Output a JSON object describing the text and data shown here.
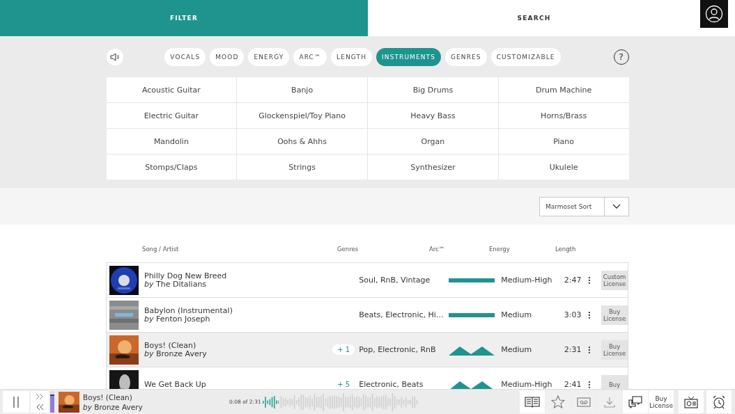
{
  "top_tabs": [
    {
      "label": "FILTER",
      "selected": true
    },
    {
      "label": "SEARCH",
      "selected": false
    }
  ],
  "filter_tabs": [
    {
      "label": "VOCALS",
      "selected": false
    },
    {
      "label": "MOOD",
      "selected": false
    },
    {
      "label": "ENERGY",
      "selected": false
    },
    {
      "label": "ARC™",
      "selected": false
    },
    {
      "label": "LENGTH",
      "selected": false
    },
    {
      "label": "INSTRUMENTS",
      "selected": true
    },
    {
      "label": "GENRES",
      "selected": false
    },
    {
      "label": "CUSTOMIZABLE",
      "selected": false
    }
  ],
  "help": "?",
  "instruments": [
    "Acoustic Guitar",
    "Banjo",
    "Big Drums",
    "Drum Machine",
    "Electric Guitar",
    "Glockenspiel/Toy Piano",
    "Heavy Bass",
    "Horns/Brass",
    "Mandolin",
    "Oohs & Ahhs",
    "Organ",
    "Piano",
    "Stomps/Claps",
    "Strings",
    "Synthesizer",
    "Ukulele"
  ],
  "sort": {
    "value": "Marmoset Sort"
  },
  "table": {
    "columns": [
      "Song / Artist",
      "Genres",
      "Arc™",
      "Energy",
      "Length"
    ],
    "rows": [
      {
        "title": "Philly Dog New Breed",
        "by": "by",
        "artist": "The Ditalians",
        "extra": null,
        "genres": "Soul, RnB, Vintage",
        "arc": {
          "kind": "flat"
        },
        "energy": "Medium-High",
        "length": "2:47",
        "license": "Custom License",
        "selected": false
      },
      {
        "title": "Babylon (Instrumental)",
        "by": "by",
        "artist": "Fenton Joseph",
        "extra": null,
        "genres": "Beats, Electronic, Hi…",
        "arc": {
          "kind": "flat"
        },
        "energy": "Medium",
        "length": "3:03",
        "license": "Buy License",
        "selected": false
      },
      {
        "title": "Boys! (Clean)",
        "by": "by",
        "artist": "Bronze Avery",
        "extra": "+ 1",
        "genres": "Pop, Electronic, RnB",
        "arc": {
          "kind": "peaks"
        },
        "energy": "Medium",
        "length": "2:31",
        "license": "Buy License",
        "selected": true
      },
      {
        "title": "We Get Back Up",
        "extra": "+ 5",
        "genres": "Electronic, Beats",
        "arc": {
          "kind": "peaks"
        },
        "energy": "Medium-High",
        "length": "2:41",
        "license": "Buy",
        "selected": false
      }
    ]
  },
  "player": {
    "playing": true,
    "volume": {
      "level": 0.85
    },
    "title": "Boys! (Clean)",
    "by": "by",
    "artist": "Bronze Avery",
    "time": "0:08 of 2:31",
    "progress": {
      "level": 0.1
    },
    "actions": [
      {
        "kind": "book",
        "disabled": false
      },
      {
        "kind": "star",
        "disabled": true
      },
      {
        "kind": "cassette",
        "disabled": true
      },
      {
        "kind": "download",
        "disabled": true
      },
      {
        "kind": "chat",
        "disabled": false
      },
      {
        "kind": "text",
        "label": "Buy License",
        "disabled": false
      }
    ],
    "extras": [
      {
        "kind": "radio",
        "disabled": false
      },
      {
        "kind": "alarm",
        "disabled": false
      }
    ]
  }
}
